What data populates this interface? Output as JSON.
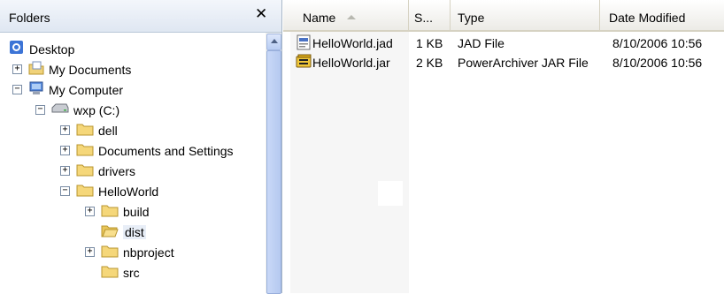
{
  "folders_pane": {
    "title": "Folders",
    "close_glyph": "✕"
  },
  "tree": [
    {
      "label": "Desktop",
      "icon": "desktop-icon",
      "expander": ""
    },
    {
      "label": "My Documents",
      "icon": "my-documents-icon",
      "expander": "+"
    },
    {
      "label": "My Computer",
      "icon": "my-computer-icon",
      "expander": "−"
    },
    {
      "label": "wxp (C:)",
      "icon": "drive-icon",
      "expander": "−"
    },
    {
      "label": "dell",
      "icon": "folder-icon",
      "expander": "+"
    },
    {
      "label": "Documents and Settings",
      "icon": "folder-icon",
      "expander": "+"
    },
    {
      "label": "drivers",
      "icon": "folder-icon",
      "expander": "+"
    },
    {
      "label": "HelloWorld",
      "icon": "folder-icon",
      "expander": "−"
    },
    {
      "label": "build",
      "icon": "folder-icon",
      "expander": "+"
    },
    {
      "label": "dist",
      "icon": "folder-icon",
      "expander": "",
      "selected": true
    },
    {
      "label": "nbproject",
      "icon": "folder-icon",
      "expander": "+"
    },
    {
      "label": "src",
      "icon": "folder-icon",
      "expander": ""
    }
  ],
  "columns": {
    "name": "Name",
    "size": "S...",
    "type": "Type",
    "date": "Date Modified"
  },
  "files": [
    {
      "name": "HelloWorld.jad",
      "size": "1 KB",
      "type": "JAD File",
      "date": "8/10/2006 10:56",
      "icon": "jad-file-icon"
    },
    {
      "name": "HelloWorld.jar",
      "size": "2 KB",
      "type": "PowerArchiver JAR File",
      "date": "8/10/2006 10:56",
      "icon": "jar-file-icon"
    }
  ]
}
